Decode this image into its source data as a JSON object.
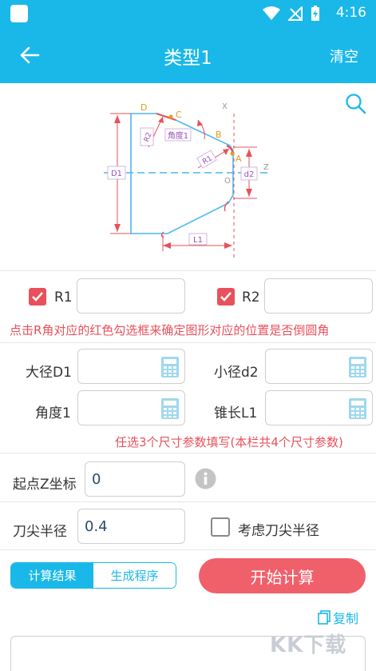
{
  "status": {
    "time": "4:16"
  },
  "appbar": {
    "title": "类型1",
    "clear": "清空"
  },
  "diagram": {
    "points": [
      "D",
      "C",
      "B",
      "A"
    ],
    "labels": {
      "r2": "R2",
      "angle": "角度1",
      "r1": "R1",
      "d1": "D1",
      "d2": "d2",
      "l1": "L1",
      "x": "X",
      "z": "Z",
      "o": "O"
    }
  },
  "radius": {
    "r1_label": "R1",
    "r2_label": "R2",
    "r1_value": "",
    "r2_value": "",
    "hint": "点击R角对应的红色勾选框来确定图形对应的位置是否倒圆角"
  },
  "dims": {
    "d1_label": "大径D1",
    "d2_label": "小径d2",
    "angle_label": "角度1",
    "l1_label": "锥长L1",
    "hint": "任选3个尺寸参数填写(本栏共4个尺寸参数)"
  },
  "start_z": {
    "label": "起点Z坐标",
    "value": "0"
  },
  "tool": {
    "label": "刀尖半径",
    "value": "0.4",
    "consider_label": "考虑刀尖半径"
  },
  "tabs": {
    "result": "计算结果",
    "program": "生成程序"
  },
  "start_button": "开始计算",
  "copy": "复制",
  "watermark": "KK下载"
}
